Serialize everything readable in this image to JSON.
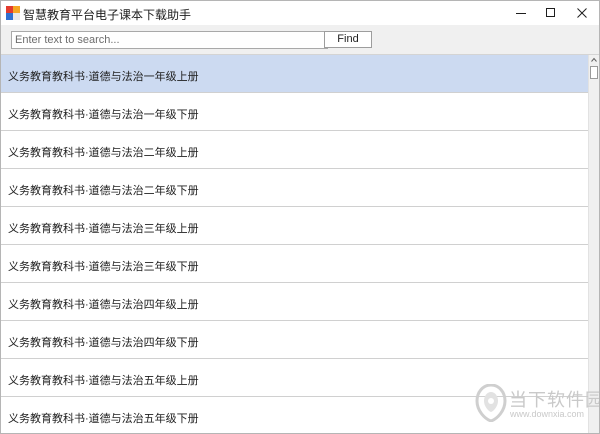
{
  "window": {
    "title": "智慧教育平台电子课本下载助手",
    "controls": {
      "minimize": "minimize-icon",
      "maximize": "maximize-icon",
      "close": "close-icon"
    }
  },
  "search": {
    "value": "",
    "placeholder": "Enter text to search...",
    "button_label": "Find"
  },
  "list": {
    "selected_index": 0,
    "items": [
      {
        "label": "义务教育教科书·道德与法治一年级上册"
      },
      {
        "label": "义务教育教科书·道德与法治一年级下册"
      },
      {
        "label": "义务教育教科书·道德与法治二年级上册"
      },
      {
        "label": "义务教育教科书·道德与法治二年级下册"
      },
      {
        "label": "义务教育教科书·道德与法治三年级上册"
      },
      {
        "label": "义务教育教科书·道德与法治三年级下册"
      },
      {
        "label": "义务教育教科书·道德与法治四年级上册"
      },
      {
        "label": "义务教育教科书·道德与法治四年级下册"
      },
      {
        "label": "义务教育教科书·道德与法治五年级上册"
      },
      {
        "label": "义务教育教科书·道德与法治五年级下册"
      }
    ]
  },
  "watermark": {
    "brand": "当下软件园",
    "url": "www.downxia.com"
  },
  "colors": {
    "selection": "#ccdaf1",
    "toolbar_bg": "#f0f0f0",
    "row_divider": "#d0d0d0",
    "icon_red": "#e23b2e",
    "icon_orange": "#f5a623",
    "icon_blue": "#2f6fd0",
    "watermark": "#c9c9c9"
  }
}
